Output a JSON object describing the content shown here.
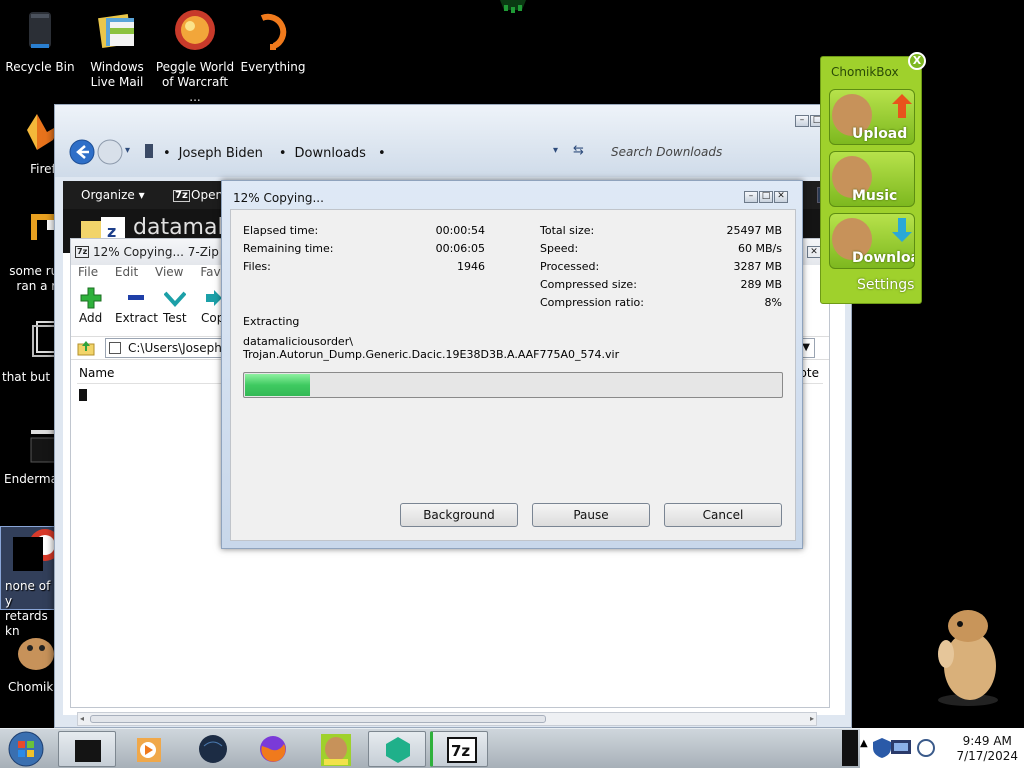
{
  "desktop": {
    "icons": [
      {
        "label": "Recycle Bin"
      },
      {
        "label": "Windows Live Mail"
      },
      {
        "label": "Peggle World of Warcraft ..."
      },
      {
        "label": "Everything"
      },
      {
        "label": "Firefox"
      },
      {
        "label": "some russ ran a ra"
      },
      {
        "label": "that but it"
      },
      {
        "label": "Enderman"
      },
      {
        "label": "none of y retards kn"
      },
      {
        "label": "ChomikB"
      }
    ]
  },
  "explorer": {
    "breadcrumb": [
      "Joseph Biden",
      "Downloads"
    ],
    "search_placeholder": "Search Downloads",
    "toolbar": {
      "organize": "Organize ▾",
      "open": "Open"
    },
    "banner_text": "datamali"
  },
  "sevenzip": {
    "title": "12% Copying... 7-Zip",
    "menu": [
      "File",
      "Edit",
      "View",
      "Favorite"
    ],
    "tools": [
      "Add",
      "Extract",
      "Test",
      "Cop"
    ],
    "path": "C:\\Users\\Joseph B",
    "columns": {
      "name": "Name",
      "right": "pte"
    }
  },
  "dialog": {
    "title": "12% Copying...",
    "left_stats": [
      {
        "label": "Elapsed time:",
        "value": "00:00:54"
      },
      {
        "label": "Remaining time:",
        "value": "00:06:05"
      },
      {
        "label": "Files:",
        "value": "1946"
      }
    ],
    "right_stats": [
      {
        "label": "Total size:",
        "value": "25497 MB"
      },
      {
        "label": "Speed:",
        "value": "60 MB/s"
      },
      {
        "label": "Processed:",
        "value": "3287 MB"
      },
      {
        "label": "Compressed size:",
        "value": "289 MB"
      },
      {
        "label": "Compression ratio:",
        "value": "8%"
      }
    ],
    "status": "Extracting",
    "file_line1": "datamaliciousorder\\",
    "file_line2": "Trojan.Autorun_Dump.Generic.Dacic.19E38D3B.A.AAF775A0_574.vir",
    "progress_fraction": 0.12,
    "buttons": {
      "background": "Background",
      "pause": "Pause",
      "cancel": "Cancel"
    }
  },
  "chomikbox": {
    "title": "ChomikBox",
    "close": "X",
    "buttons": [
      "Upload",
      "Music",
      "Download"
    ],
    "settings": "Settings"
  },
  "taskbar": {
    "time": "9:49 AM",
    "date": "7/17/2024"
  }
}
